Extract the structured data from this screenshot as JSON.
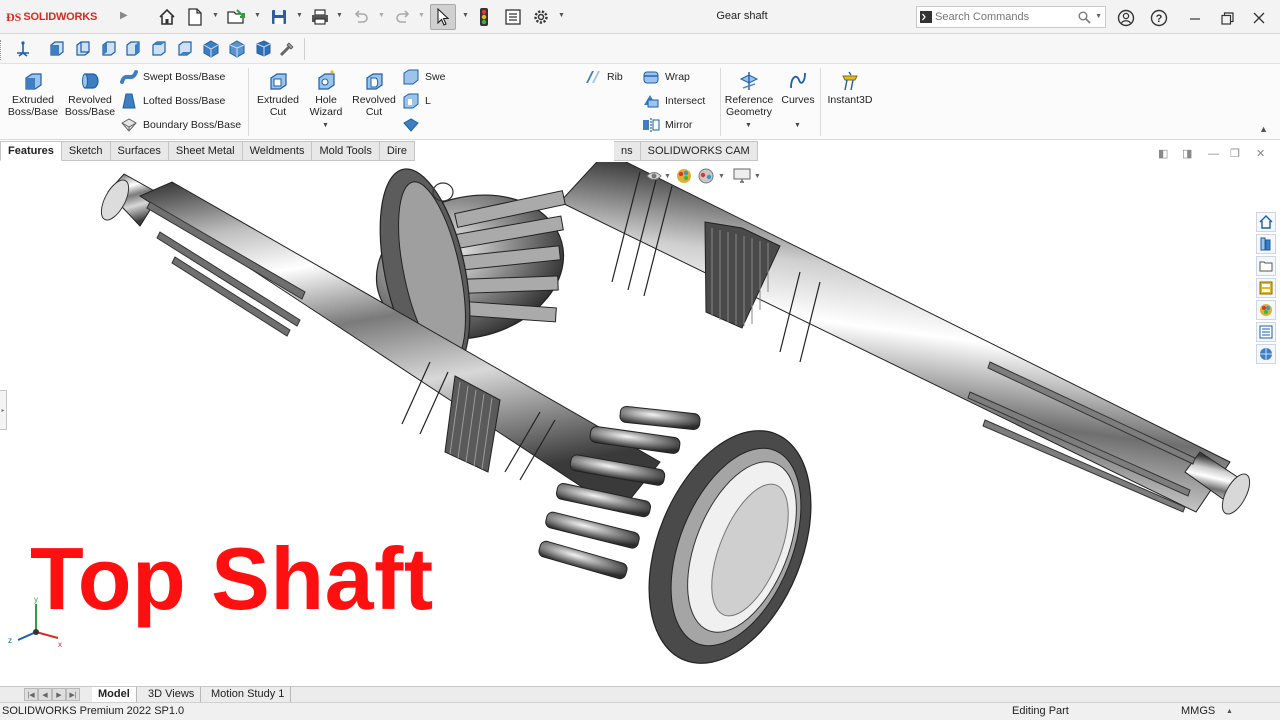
{
  "app": {
    "brand": "SOLIDWORKS",
    "document_title": "Gear shaft"
  },
  "search": {
    "placeholder": "Search Commands"
  },
  "ribbon": {
    "extruded_boss": [
      "Extruded",
      "Boss/Base"
    ],
    "revolved_boss": [
      "Revolved",
      "Boss/Base"
    ],
    "swept_boss": "Swept Boss/Base",
    "lofted_boss": "Lofted Boss/Base",
    "boundary_boss": "Boundary Boss/Base",
    "extruded_cut": [
      "Extruded",
      "Cut"
    ],
    "hole_wizard": [
      "Hole",
      "Wizard"
    ],
    "revolved_cut": [
      "Revolved",
      "Cut"
    ],
    "swept_cut_partial": "Swe",
    "lofted_cut_partial": "L",
    "rib": "Rib",
    "wrap": "Wrap",
    "intersect": "Intersect",
    "mirror": "Mirror",
    "reference_geometry": [
      "Reference",
      "Geometry"
    ],
    "curves": "Curves",
    "instant3d": "Instant3D"
  },
  "tabs": {
    "features": "Features",
    "sketch": "Sketch",
    "surfaces": "Surfaces",
    "sheet_metal": "Sheet Metal",
    "weldments": "Weldments",
    "mold_tools": "Mold Tools",
    "direct_editing_partial": "Dire",
    "hidden_partial": "ns",
    "solidworks_cam": "SOLIDWORKS CAM"
  },
  "overlay": {
    "title": "Top Shaft"
  },
  "triad": {
    "x": "x",
    "y": "y",
    "z": "z"
  },
  "bottom_tabs": {
    "model": "Model",
    "views_3d": "3D Views",
    "motion_study": "Motion Study 1"
  },
  "status": {
    "product": "SOLIDWORKS Premium 2022 SP1.0",
    "mode": "Editing Part",
    "units": "MMGS"
  },
  "colors": {
    "brand_red": "#d52b1e",
    "title_red": "#ff1010",
    "icon_blue": "#3f7fc1",
    "metal_dark": "#3a3a3a",
    "metal_light": "#e8e8e8"
  }
}
